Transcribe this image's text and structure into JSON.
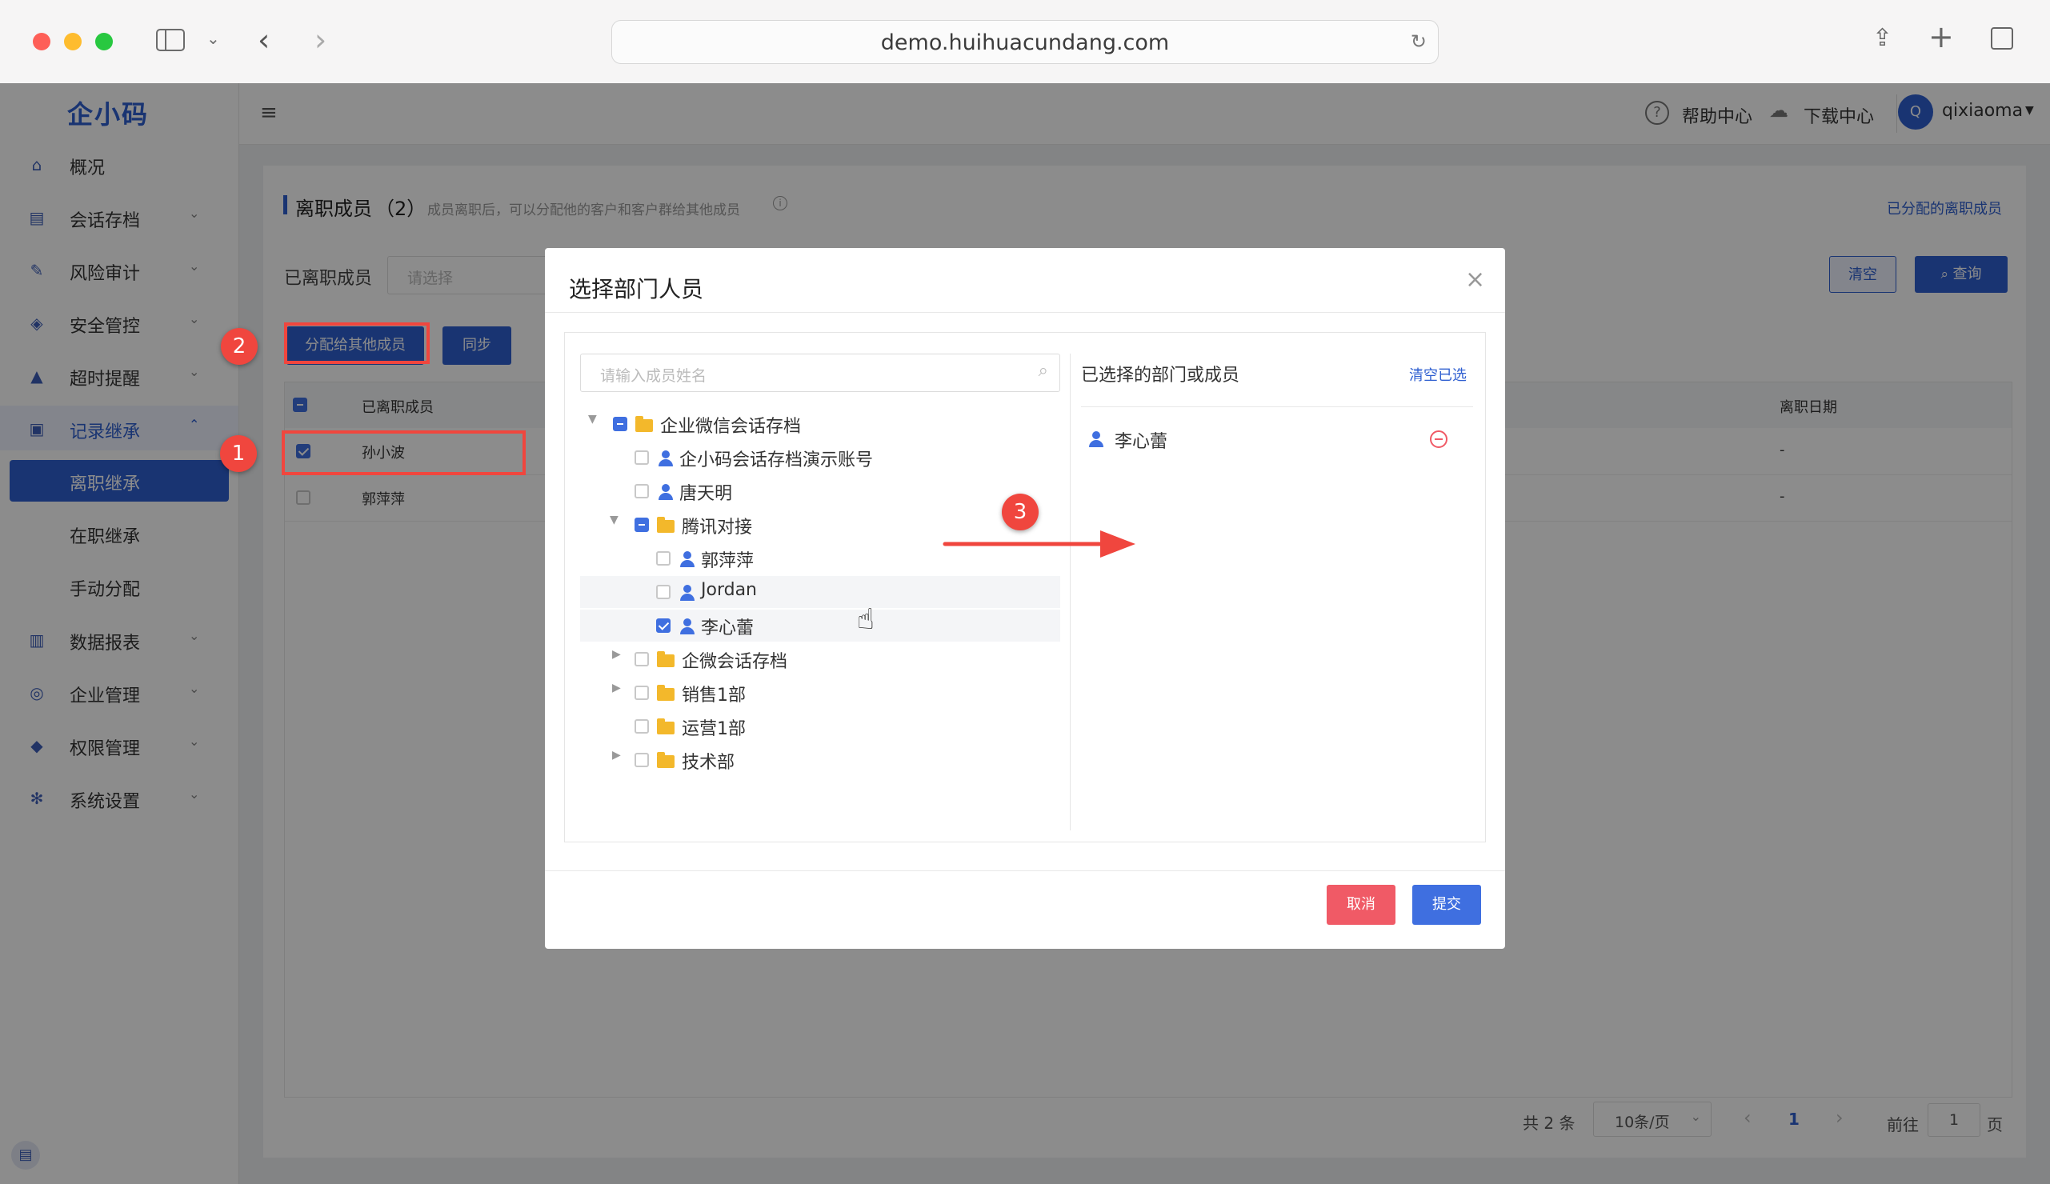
{
  "browser": {
    "url": "demo.huihuacundang.com"
  },
  "app": {
    "logo": "企小码"
  },
  "sidebar": {
    "items": [
      {
        "label": "概况",
        "icon": "home-icon"
      },
      {
        "label": "会话存档",
        "icon": "chat-archive-icon"
      },
      {
        "label": "风险审计",
        "icon": "audit-icon"
      },
      {
        "label": "安全管控",
        "icon": "shield-icon"
      },
      {
        "label": "超时提醒",
        "icon": "bell-icon"
      },
      {
        "label": "记录继承",
        "icon": "record-icon"
      },
      {
        "label": "数据报表",
        "icon": "chart-icon"
      },
      {
        "label": "企业管理",
        "icon": "enterprise-icon"
      },
      {
        "label": "权限管理",
        "icon": "permission-icon"
      },
      {
        "label": "系统设置",
        "icon": "gear-icon"
      }
    ],
    "subitems": [
      "离职继承",
      "在职继承",
      "手动分配"
    ]
  },
  "topbar": {
    "help": "帮助中心",
    "download": "下载中心",
    "avatar_letter": "Q",
    "user": "qixiaoma"
  },
  "page": {
    "title": "离职成员",
    "count": "（2）",
    "hint": "成员离职后，可以分配他的客户和客户群给其他成员",
    "assigned_link": "已分配的离职成员",
    "filter_label": "已离职成员",
    "filter_placeholder": "请选择",
    "clear_btn": "清空",
    "query_btn": "查询",
    "assign_btn": "分配给其他成员",
    "sync_btn": "同步",
    "columns": [
      "已离职成员",
      "离职日期"
    ],
    "rows": [
      {
        "name": "孙小波",
        "date": "-"
      },
      {
        "name": "郭萍萍",
        "date": "-"
      }
    ],
    "total": "共 2 条",
    "page_size": "10条/页",
    "current_page": "1",
    "goto_prefix": "前往",
    "goto_value": "1",
    "goto_suffix": "页"
  },
  "modal": {
    "title": "选择部门人员",
    "search_placeholder": "请输入成员姓名",
    "selected_title": "已选择的部门或成员",
    "clear_selected": "清空已选",
    "tree": [
      "企业微信会话存档",
      "企小码会话存档演示账号",
      "唐天明",
      "腾讯对接",
      "郭萍萍",
      "Jordan",
      "李心蕾",
      "企微会话存档",
      "销售1部",
      "运营1部",
      "技术部"
    ],
    "selected": [
      "李心蕾"
    ],
    "cancel": "取消",
    "submit": "提交"
  },
  "annotations": [
    "1",
    "2",
    "3"
  ],
  "colors": {
    "primary": "#3f6fe0",
    "danger": "#f05a66",
    "annotation": "#f0463e",
    "folder": "#f3b82b"
  }
}
